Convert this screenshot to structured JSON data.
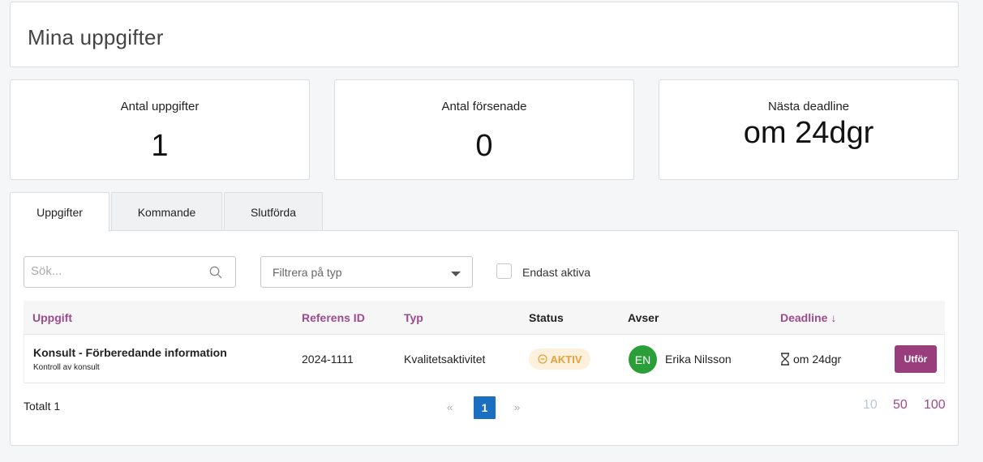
{
  "page_title": "Mina uppgifter",
  "stats": [
    {
      "label": "Antal uppgifter",
      "value": "1"
    },
    {
      "label": "Antal försenade",
      "value": "0"
    },
    {
      "label": "Nästa deadline",
      "value": "om 24dgr"
    }
  ],
  "tabs": [
    {
      "label": "Uppgifter",
      "active": true
    },
    {
      "label": "Kommande",
      "active": false
    },
    {
      "label": "Slutförda",
      "active": false
    }
  ],
  "filters": {
    "search_placeholder": "Sök...",
    "type_placeholder": "Filtrera på typ",
    "only_active_label": "Endast aktiva",
    "only_active_checked": false
  },
  "table": {
    "columns": [
      "Uppgift",
      "Referens ID",
      "Typ",
      "Status",
      "Avser",
      "Deadline"
    ],
    "sorted_column": "Deadline",
    "sort_icon": "arrow-down-icon",
    "rows": [
      {
        "task": "Konsult - Förberedande information",
        "subtitle": "Kontroll av konsult",
        "reference": "2024-1111",
        "type": "Kvalitetsaktivitet",
        "status": "AKTIV",
        "avatar_initials": "EN",
        "person": "Erika Nilsson",
        "deadline": "om 24dgr",
        "action": "Utför"
      }
    ]
  },
  "footer": {
    "total": "Totalt 1",
    "prev": "«",
    "current_page": "1",
    "next": "»",
    "page_sizes": [
      "10",
      "50",
      "100"
    ]
  },
  "colors": {
    "accent_purple": "#9e4a8d",
    "button_purple": "#9a3d7d",
    "page_blue": "#1a6fc1",
    "avatar_green": "#2a9f38",
    "status_orange": "#e5a13a",
    "status_bg": "#fdf0dc"
  }
}
